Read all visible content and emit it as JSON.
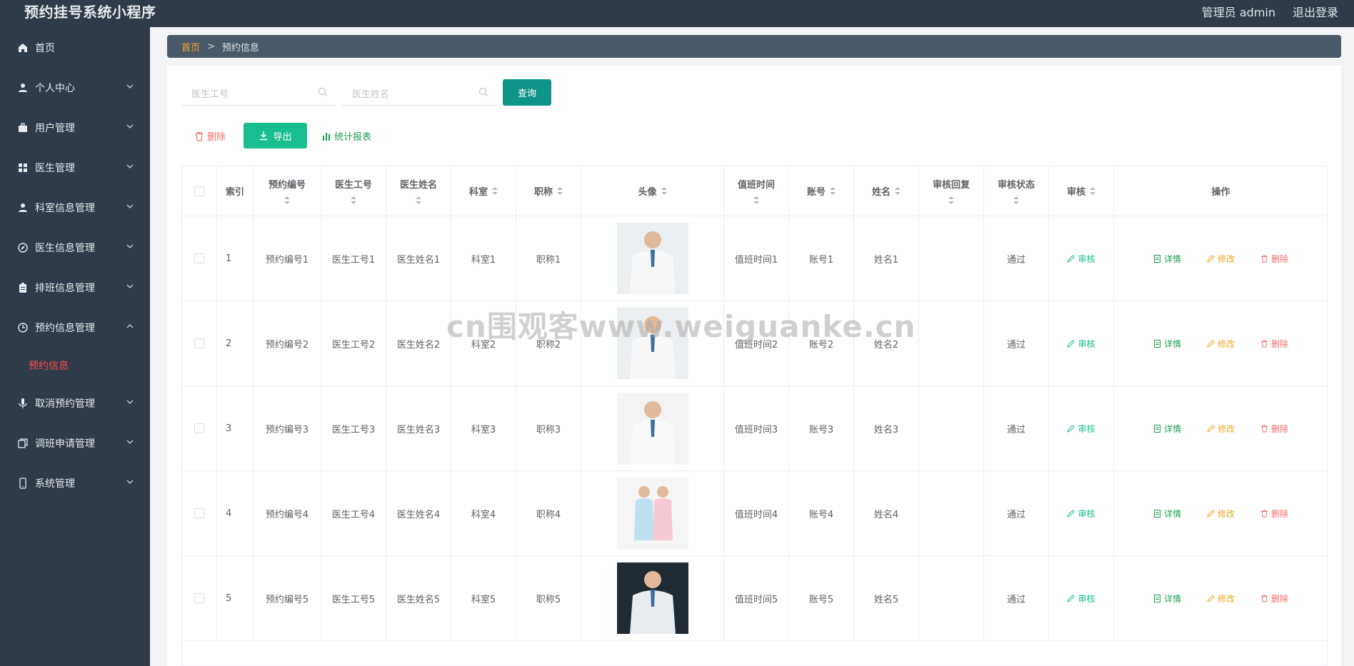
{
  "app": {
    "title": "预约挂号系统小程序",
    "user": "管理员 admin",
    "logout": "退出登录"
  },
  "sidebar": {
    "items": [
      {
        "label": "首页",
        "icon": "home-icon"
      },
      {
        "label": "个人中心",
        "icon": "user-icon"
      },
      {
        "label": "用户管理",
        "icon": "briefcase-icon"
      },
      {
        "label": "医生管理",
        "icon": "grid-icon"
      },
      {
        "label": "科室信息管理",
        "icon": "user-icon"
      },
      {
        "label": "医生信息管理",
        "icon": "compass-icon"
      },
      {
        "label": "排班信息管理",
        "icon": "clipboard-icon"
      },
      {
        "label": "预约信息管理",
        "icon": "clock-icon"
      },
      {
        "label": "取消预约管理",
        "icon": "mic-icon"
      },
      {
        "label": "调班申请管理",
        "icon": "copy-icon"
      },
      {
        "label": "系统管理",
        "icon": "phone-icon"
      }
    ],
    "active_sub": "预约信息"
  },
  "breadcrumb": {
    "home": "首页",
    "separator": ">",
    "current": "预约信息"
  },
  "search": {
    "doctor_id_placeholder": "医生工号",
    "doctor_name_placeholder": "医生姓名",
    "query_label": "查询"
  },
  "toolbar": {
    "delete_label": "删除",
    "export_label": "导出",
    "stats_label": "统计报表"
  },
  "table": {
    "headers": [
      "索引",
      "预约编号",
      "医生工号",
      "医生姓名",
      "科室",
      "职称",
      "头像",
      "值班时间",
      "账号",
      "姓名",
      "审核回复",
      "审核状态",
      "审核",
      "操作"
    ],
    "rows": [
      {
        "index": "1",
        "booking_no": "预约编号1",
        "doctor_id": "医生工号1",
        "doctor_name": "医生姓名1",
        "dept": "科室1",
        "title": "职称1",
        "duty_time": "值班时间1",
        "account": "账号1",
        "name": "姓名1",
        "reply": "",
        "status": "通过"
      },
      {
        "index": "2",
        "booking_no": "预约编号2",
        "doctor_id": "医生工号2",
        "doctor_name": "医生姓名2",
        "dept": "科室2",
        "title": "职称2",
        "duty_time": "值班时间2",
        "account": "账号2",
        "name": "姓名2",
        "reply": "",
        "status": "通过"
      },
      {
        "index": "3",
        "booking_no": "预约编号3",
        "doctor_id": "医生工号3",
        "doctor_name": "医生姓名3",
        "dept": "科室3",
        "title": "职称3",
        "duty_time": "值班时间3",
        "account": "账号3",
        "name": "姓名3",
        "reply": "",
        "status": "通过"
      },
      {
        "index": "4",
        "booking_no": "预约编号4",
        "doctor_id": "医生工号4",
        "doctor_name": "医生姓名4",
        "dept": "科室4",
        "title": "职称4",
        "duty_time": "值班时间4",
        "account": "账号4",
        "name": "姓名4",
        "reply": "",
        "status": "通过"
      },
      {
        "index": "5",
        "booking_no": "预约编号5",
        "doctor_id": "医生工号5",
        "doctor_name": "医生姓名5",
        "dept": "科室5",
        "title": "职称5",
        "duty_time": "值班时间5",
        "account": "账号5",
        "name": "姓名5",
        "reply": "",
        "status": "通过"
      }
    ],
    "actions": {
      "review": "审核",
      "detail": "详情",
      "edit": "修改",
      "remove": "删除"
    }
  },
  "watermark": "cn围观客www.weiguanke.cn",
  "colors": {
    "sidebar_bg": "#2f3b48",
    "accent_teal": "#0f9488",
    "export_green": "#19be8f",
    "danger": "#f56c6c",
    "warning": "#f5a623",
    "active_menu": "#ff4d4f"
  }
}
